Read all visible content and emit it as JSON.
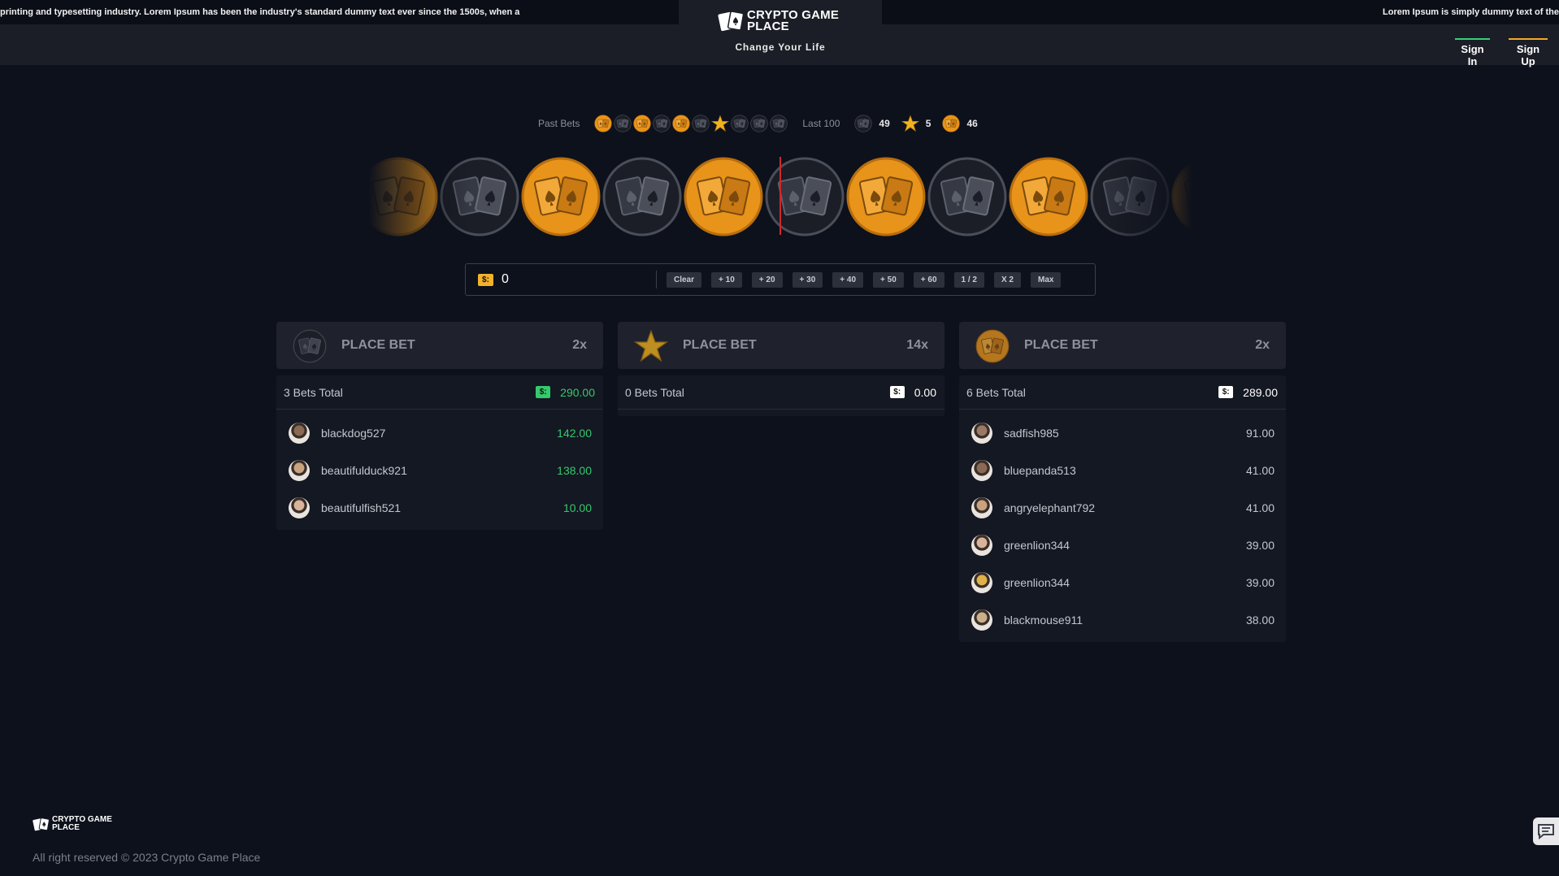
{
  "ticker": {
    "left_text": "printing and typesetting industry. Lorem Ipsum has been the industry's standard dummy text ever since the 1500s, when a",
    "right_text": "Lorem Ipsum is simply dummy text of the"
  },
  "header": {
    "brand_name": "CRYPTO GAME PLACE",
    "tagline": "Change Your Life",
    "sign_in": "Sign In",
    "sign_up": "Sign Up"
  },
  "history": {
    "past_label": "Past Bets",
    "past_results": [
      "gold-cards-icon",
      "dark-cards-icon",
      "gold-cards-icon",
      "dark-cards-icon",
      "gold-cards-icon",
      "dark-cards-icon",
      "star-icon",
      "dark-cards-icon",
      "dark-cards-icon",
      "dark-cards-icon"
    ],
    "last_label": "Last 100",
    "dark_count": "49",
    "star_count": "5",
    "gold_count": "46"
  },
  "roulette": {
    "sequence": [
      "gold",
      "dark",
      "gold",
      "dark",
      "gold",
      "dark",
      "gold",
      "dark",
      "gold",
      "dark",
      "gold"
    ]
  },
  "bet_input": {
    "currency_symbol": "$:",
    "value": "0",
    "buttons": [
      "Clear",
      "+ 10",
      "+ 20",
      "+ 30",
      "+ 40",
      "+ 50",
      "+ 60",
      "1 / 2",
      "X 2",
      "Max"
    ]
  },
  "panels": [
    {
      "icon": "dark-cards-icon",
      "title": "PLACE BET",
      "multiplier": "2x",
      "total_label": "3 Bets Total",
      "currency_symbol": "$:",
      "total_amount": "290.00",
      "amount_color": "#35c96d",
      "badge_color": "#35c96d",
      "bets": [
        {
          "user": "blackdog527",
          "amount": "142.00"
        },
        {
          "user": "beautifulduck921",
          "amount": "138.00"
        },
        {
          "user": "beautifulfish521",
          "amount": "10.00"
        }
      ]
    },
    {
      "icon": "star-icon",
      "title": "PLACE BET",
      "multiplier": "14x",
      "total_label": "0 Bets Total",
      "currency_symbol": "$:",
      "total_amount": "0.00",
      "amount_color": "#ffffff",
      "badge_color": "#ffffff",
      "bets": []
    },
    {
      "icon": "gold-cards-icon",
      "title": "PLACE BET",
      "multiplier": "2x",
      "total_label": "6 Bets Total",
      "currency_symbol": "$:",
      "total_amount": "289.00",
      "amount_color": "#ffffff",
      "badge_color": "#ffffff",
      "bets": [
        {
          "user": "sadfish985",
          "amount": "91.00"
        },
        {
          "user": "bluepanda513",
          "amount": "41.00"
        },
        {
          "user": "angryelephant792",
          "amount": "41.00"
        },
        {
          "user": "greenlion344",
          "amount": "39.00"
        },
        {
          "user": "greenlion344",
          "amount": "39.00"
        },
        {
          "user": "blackmouse911",
          "amount": "38.00"
        }
      ]
    }
  ],
  "footer": {
    "brand_name": "CRYPTO GAME PLACE",
    "copyright": "All right reserved © 2023 Crypto Game Place"
  },
  "colors": {
    "background": "#0d111c",
    "gold": "#e8941a",
    "green": "#35c96d",
    "accent_red": "#d2262c"
  }
}
